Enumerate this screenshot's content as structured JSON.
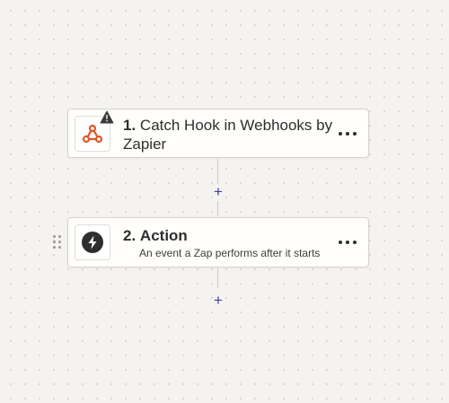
{
  "steps": [
    {
      "number": "1.",
      "title": "Catch Hook in Webhooks by Zapier",
      "icon": "webhook-icon",
      "warning": true
    },
    {
      "number": "2.",
      "title": "Action",
      "subtitle": "An event a Zap performs after it starts",
      "icon": "lightning-bolt-icon"
    }
  ],
  "colors": {
    "canvas": "#f4f3f0",
    "webhook_accent": "#e0572b",
    "plus_accent": "#3d3f8f",
    "warning": "#3b3b3b"
  },
  "add_step_glyph": "+"
}
